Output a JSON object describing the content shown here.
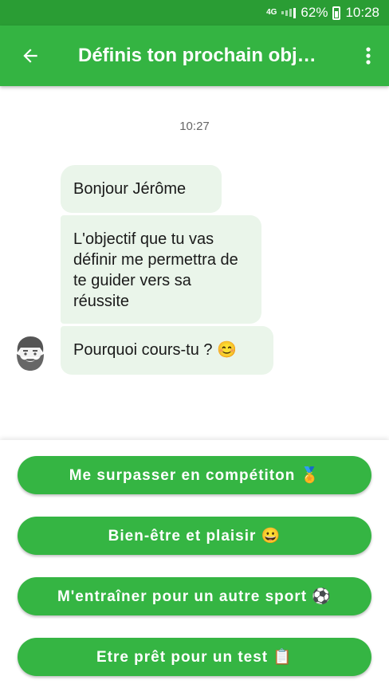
{
  "status_bar": {
    "network": "4G",
    "battery": "62%",
    "time": "10:28"
  },
  "app_bar": {
    "title": "Définis ton prochain obj…",
    "back_icon": "arrow-left-icon",
    "menu_icon": "more-vertical-icon"
  },
  "chat": {
    "time": "10:27",
    "messages": [
      {
        "text": "Bonjour Jérôme"
      },
      {
        "text": "L'objectif que tu vas définir me permettra de te guider vers sa réussite"
      },
      {
        "text": "Pourquoi cours-tu ? 😊"
      }
    ],
    "avatar_icon": "coach-avatar-icon"
  },
  "choices": [
    {
      "label": "Me surpasser en compétiton 🏅"
    },
    {
      "label": "Bien-être et plaisir 😀"
    },
    {
      "label": "M'entraîner pour un autre sport ⚽"
    },
    {
      "label": "Etre prêt pour un test 📋"
    }
  ],
  "colors": {
    "status_bar": "#2a9d34",
    "app_bar": "#34b442",
    "button": "#35b543",
    "bubble": "#eaf5ea"
  }
}
